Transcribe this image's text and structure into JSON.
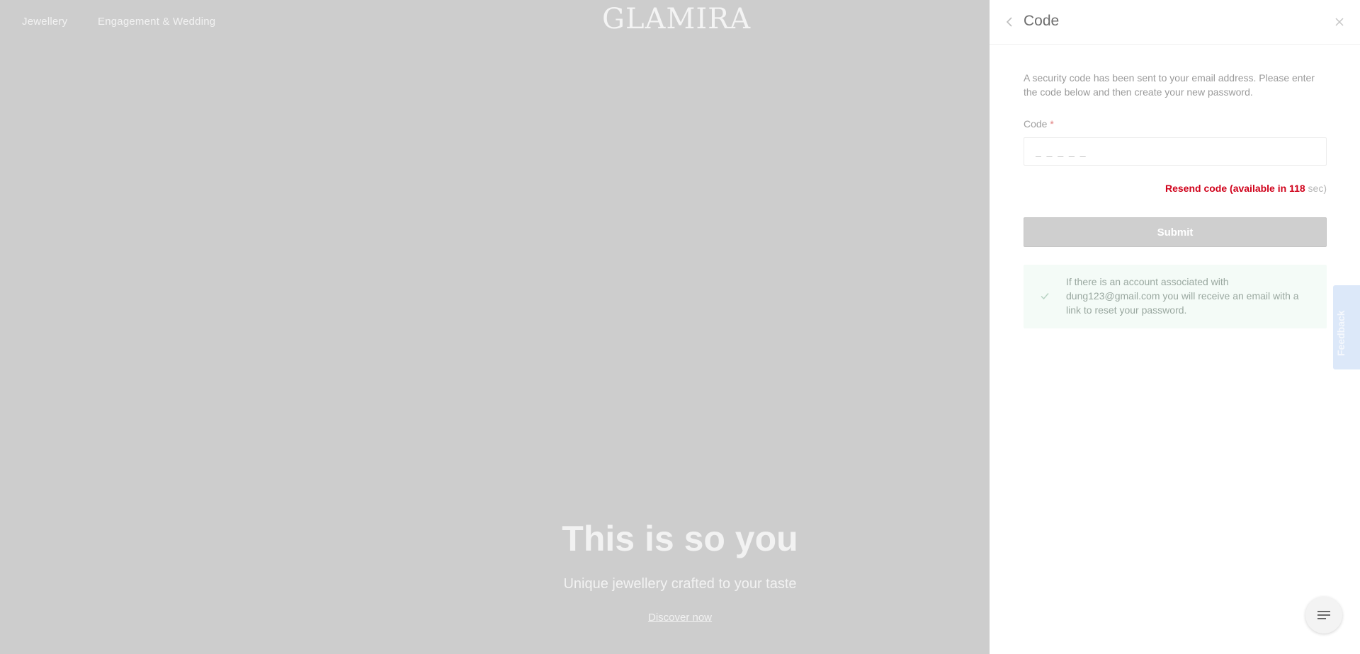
{
  "header": {
    "nav": [
      {
        "label": "Jewellery"
      },
      {
        "label": "Engagement & Wedding"
      }
    ],
    "logo_text": "GLAMIRA"
  },
  "hero": {
    "title": "This is so you",
    "subtitle": "Unique jewellery crafted to your taste",
    "link": "Discover now"
  },
  "drawer": {
    "title": "Code",
    "intro": "A security code has been sent to your email address. Please enter the code below and then create your new password.",
    "code_label": "Code",
    "code_required_mark": "*",
    "code_placeholder": "_ _ _ _ _",
    "code_value": "",
    "resend_text": "Resend code (available in 118",
    "resend_unit": " sec)",
    "submit_label": "Submit",
    "notice_text": "If there is an account associated with dung123@gmail.com you will receive an email with a link to reset your password."
  },
  "feedback": {
    "label": "Feedback"
  },
  "colors": {
    "overlay": "#cdcdcd",
    "resend_accent": "#d0021b",
    "notice_bg": "#f4fbf7",
    "feedback_bg": "#dce8f9"
  },
  "icons": {
    "back": "chevron-left-icon",
    "close": "close-icon",
    "notice": "check-icon",
    "feedback": "star-icon",
    "chat": "chat-icon"
  }
}
